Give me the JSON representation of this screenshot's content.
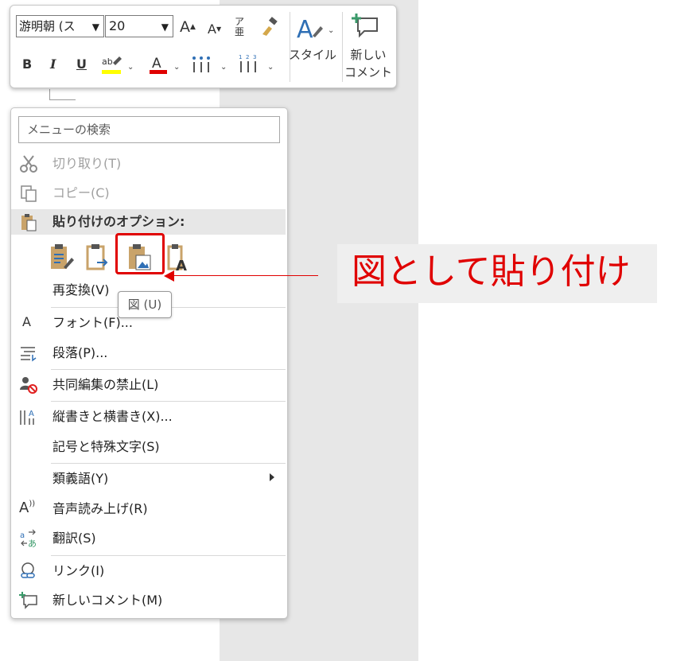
{
  "toolbar": {
    "font_name": "游明朝 (ス",
    "font_size": "20",
    "grow_font": "A",
    "shrink_font": "A",
    "phonetic_guide": "ア亜",
    "bold": "B",
    "italic": "I",
    "underline": "U",
    "font_color": "A",
    "styles_label": "スタイル",
    "new_comment_label_1": "新しい",
    "new_comment_label_2": "コメント",
    "highlight_color": "#ffff00",
    "font_color_value": "#e00000"
  },
  "menu": {
    "search_placeholder": "メニューの検索",
    "items": [
      {
        "label": "切り取り(T)",
        "enabled": false
      },
      {
        "label": "コピー(C)",
        "enabled": false
      },
      {
        "label": "貼り付けのオプション:",
        "enabled": true
      },
      {
        "label": "再変換(V)",
        "enabled": true
      },
      {
        "label": "フォント(F)...",
        "enabled": true
      },
      {
        "label": "段落(P)...",
        "enabled": true
      },
      {
        "label": "共同編集の禁止(L)",
        "enabled": true
      },
      {
        "label": "縦書きと横書き(X)...",
        "enabled": true
      },
      {
        "label": "記号と特殊文字(S)",
        "enabled": true
      },
      {
        "label": "類義語(Y)",
        "enabled": true
      },
      {
        "label": "音声読み上げ(R)",
        "enabled": true
      },
      {
        "label": "翻訳(S)",
        "enabled": true
      },
      {
        "label": "リンク(I)",
        "enabled": true
      },
      {
        "label": "新しいコメント(M)",
        "enabled": true
      }
    ]
  },
  "tooltip": "図 (U)",
  "annotation": "図として貼り付け",
  "colors": {
    "accent_blue": "#2f6fb5",
    "annotation_red": "#e00000",
    "comment_green": "#3a9a6a"
  }
}
